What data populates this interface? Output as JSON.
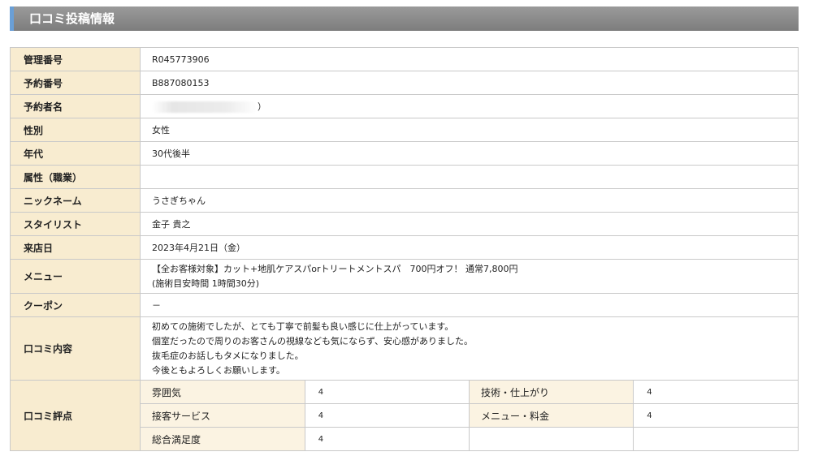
{
  "page": {
    "title": "口コミ投稿情報"
  },
  "rows": {
    "kanri": {
      "label": "管理番号",
      "value": "R045773906"
    },
    "yoyaku": {
      "label": "予約番号",
      "value": "B887080153"
    },
    "yoyakusha": {
      "label": "予約者名",
      "value_suffix": "）"
    },
    "seibetsu": {
      "label": "性別",
      "value": "女性"
    },
    "nendai": {
      "label": "年代",
      "value": "30代後半"
    },
    "zokusei": {
      "label": "属性（職業）",
      "value": ""
    },
    "nickname": {
      "label": "ニックネーム",
      "value": "うさぎちゃん"
    },
    "stylist": {
      "label": "スタイリスト",
      "value": "金子 貴之"
    },
    "raiten": {
      "label": "来店日",
      "value": "2023年4月21日（金）"
    },
    "menu": {
      "label": "メニュー",
      "line1": "【全お客様対象】カット+地肌ケアスパorトリートメントスパ　700円オフ！ 通常7,800円",
      "line2": "(施術目安時間 1時間30分)"
    },
    "coupon": {
      "label": "クーポン",
      "value": "－"
    },
    "review": {
      "label": "口コミ内容",
      "lines": [
        "初めての施術でしたが、とても丁寧で前髪も良い感じに仕上がっています。",
        "個室だったので周りのお客さんの視線なども気にならず、安心感がありました。",
        "抜毛症のお話しもタメになりました。",
        "今後ともよろしくお願いします。"
      ]
    },
    "ratings": {
      "label": "口コミ評点",
      "items": [
        {
          "label": "雰囲気",
          "value": "4"
        },
        {
          "label": "技術・仕上がり",
          "value": "4"
        },
        {
          "label": "接客サービス",
          "value": "4"
        },
        {
          "label": "メニュー・料金",
          "value": "4"
        },
        {
          "label": "総合満足度",
          "value": "4"
        }
      ]
    }
  }
}
